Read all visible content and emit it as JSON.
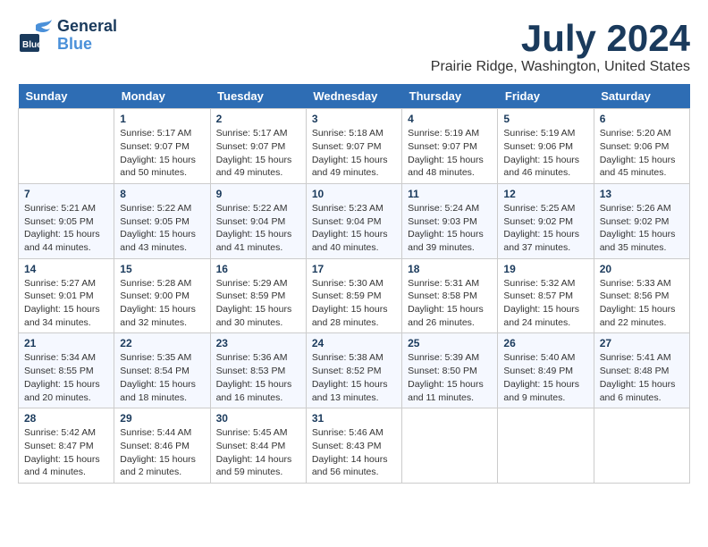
{
  "header": {
    "logo_general": "General",
    "logo_blue": "Blue",
    "month_year": "July 2024",
    "location": "Prairie Ridge, Washington, United States"
  },
  "days_of_week": [
    "Sunday",
    "Monday",
    "Tuesday",
    "Wednesday",
    "Thursday",
    "Friday",
    "Saturday"
  ],
  "weeks": [
    [
      {
        "day": "",
        "info": ""
      },
      {
        "day": "1",
        "info": "Sunrise: 5:17 AM\nSunset: 9:07 PM\nDaylight: 15 hours\nand 50 minutes."
      },
      {
        "day": "2",
        "info": "Sunrise: 5:17 AM\nSunset: 9:07 PM\nDaylight: 15 hours\nand 49 minutes."
      },
      {
        "day": "3",
        "info": "Sunrise: 5:18 AM\nSunset: 9:07 PM\nDaylight: 15 hours\nand 49 minutes."
      },
      {
        "day": "4",
        "info": "Sunrise: 5:19 AM\nSunset: 9:07 PM\nDaylight: 15 hours\nand 48 minutes."
      },
      {
        "day": "5",
        "info": "Sunrise: 5:19 AM\nSunset: 9:06 PM\nDaylight: 15 hours\nand 46 minutes."
      },
      {
        "day": "6",
        "info": "Sunrise: 5:20 AM\nSunset: 9:06 PM\nDaylight: 15 hours\nand 45 minutes."
      }
    ],
    [
      {
        "day": "7",
        "info": "Sunrise: 5:21 AM\nSunset: 9:05 PM\nDaylight: 15 hours\nand 44 minutes."
      },
      {
        "day": "8",
        "info": "Sunrise: 5:22 AM\nSunset: 9:05 PM\nDaylight: 15 hours\nand 43 minutes."
      },
      {
        "day": "9",
        "info": "Sunrise: 5:22 AM\nSunset: 9:04 PM\nDaylight: 15 hours\nand 41 minutes."
      },
      {
        "day": "10",
        "info": "Sunrise: 5:23 AM\nSunset: 9:04 PM\nDaylight: 15 hours\nand 40 minutes."
      },
      {
        "day": "11",
        "info": "Sunrise: 5:24 AM\nSunset: 9:03 PM\nDaylight: 15 hours\nand 39 minutes."
      },
      {
        "day": "12",
        "info": "Sunrise: 5:25 AM\nSunset: 9:02 PM\nDaylight: 15 hours\nand 37 minutes."
      },
      {
        "day": "13",
        "info": "Sunrise: 5:26 AM\nSunset: 9:02 PM\nDaylight: 15 hours\nand 35 minutes."
      }
    ],
    [
      {
        "day": "14",
        "info": "Sunrise: 5:27 AM\nSunset: 9:01 PM\nDaylight: 15 hours\nand 34 minutes."
      },
      {
        "day": "15",
        "info": "Sunrise: 5:28 AM\nSunset: 9:00 PM\nDaylight: 15 hours\nand 32 minutes."
      },
      {
        "day": "16",
        "info": "Sunrise: 5:29 AM\nSunset: 8:59 PM\nDaylight: 15 hours\nand 30 minutes."
      },
      {
        "day": "17",
        "info": "Sunrise: 5:30 AM\nSunset: 8:59 PM\nDaylight: 15 hours\nand 28 minutes."
      },
      {
        "day": "18",
        "info": "Sunrise: 5:31 AM\nSunset: 8:58 PM\nDaylight: 15 hours\nand 26 minutes."
      },
      {
        "day": "19",
        "info": "Sunrise: 5:32 AM\nSunset: 8:57 PM\nDaylight: 15 hours\nand 24 minutes."
      },
      {
        "day": "20",
        "info": "Sunrise: 5:33 AM\nSunset: 8:56 PM\nDaylight: 15 hours\nand 22 minutes."
      }
    ],
    [
      {
        "day": "21",
        "info": "Sunrise: 5:34 AM\nSunset: 8:55 PM\nDaylight: 15 hours\nand 20 minutes."
      },
      {
        "day": "22",
        "info": "Sunrise: 5:35 AM\nSunset: 8:54 PM\nDaylight: 15 hours\nand 18 minutes."
      },
      {
        "day": "23",
        "info": "Sunrise: 5:36 AM\nSunset: 8:53 PM\nDaylight: 15 hours\nand 16 minutes."
      },
      {
        "day": "24",
        "info": "Sunrise: 5:38 AM\nSunset: 8:52 PM\nDaylight: 15 hours\nand 13 minutes."
      },
      {
        "day": "25",
        "info": "Sunrise: 5:39 AM\nSunset: 8:50 PM\nDaylight: 15 hours\nand 11 minutes."
      },
      {
        "day": "26",
        "info": "Sunrise: 5:40 AM\nSunset: 8:49 PM\nDaylight: 15 hours\nand 9 minutes."
      },
      {
        "day": "27",
        "info": "Sunrise: 5:41 AM\nSunset: 8:48 PM\nDaylight: 15 hours\nand 6 minutes."
      }
    ],
    [
      {
        "day": "28",
        "info": "Sunrise: 5:42 AM\nSunset: 8:47 PM\nDaylight: 15 hours\nand 4 minutes."
      },
      {
        "day": "29",
        "info": "Sunrise: 5:44 AM\nSunset: 8:46 PM\nDaylight: 15 hours\nand 2 minutes."
      },
      {
        "day": "30",
        "info": "Sunrise: 5:45 AM\nSunset: 8:44 PM\nDaylight: 14 hours\nand 59 minutes."
      },
      {
        "day": "31",
        "info": "Sunrise: 5:46 AM\nSunset: 8:43 PM\nDaylight: 14 hours\nand 56 minutes."
      },
      {
        "day": "",
        "info": ""
      },
      {
        "day": "",
        "info": ""
      },
      {
        "day": "",
        "info": ""
      }
    ]
  ]
}
